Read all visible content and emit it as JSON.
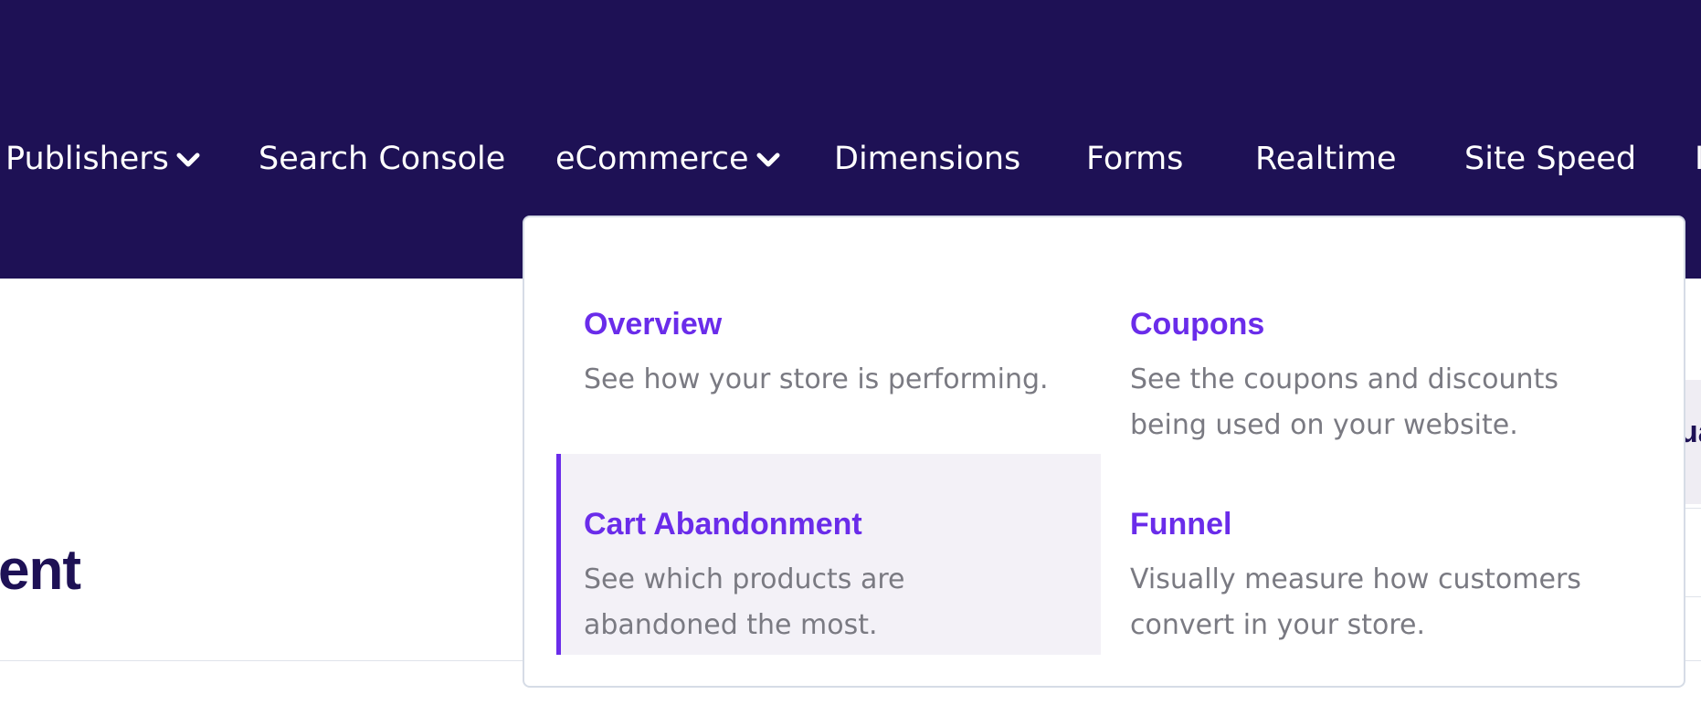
{
  "nav": {
    "items": [
      {
        "label": "Publishers",
        "has_dropdown": true
      },
      {
        "label": "Search Console",
        "has_dropdown": false
      },
      {
        "label": "eCommerce",
        "has_dropdown": true
      },
      {
        "label": "Dimensions",
        "has_dropdown": false
      },
      {
        "label": "Forms",
        "has_dropdown": false
      },
      {
        "label": "Realtime",
        "has_dropdown": false
      },
      {
        "label": "Site Speed",
        "has_dropdown": false
      },
      {
        "label": "I",
        "has_dropdown": false
      }
    ]
  },
  "page": {
    "heading": "ent",
    "right_panel_text": "ua"
  },
  "dropdown": {
    "items": [
      {
        "title": "Overview",
        "description": "See how your store is performing."
      },
      {
        "title": "Coupons",
        "description": "See the coupons and discounts being used on your website."
      },
      {
        "title": "Cart Abandonment",
        "description": "See which products are abandoned the most.",
        "active": true
      },
      {
        "title": "Funnel",
        "description": "Visually measure how customers convert in your store."
      }
    ]
  },
  "colors": {
    "header_bg": "#1e1155",
    "accent": "#6a2cea",
    "desc_text": "#7a7a82",
    "active_item_bg": "#f3f1f7"
  },
  "icons": {
    "dropdown_indicator": "chevron-down-icon"
  }
}
